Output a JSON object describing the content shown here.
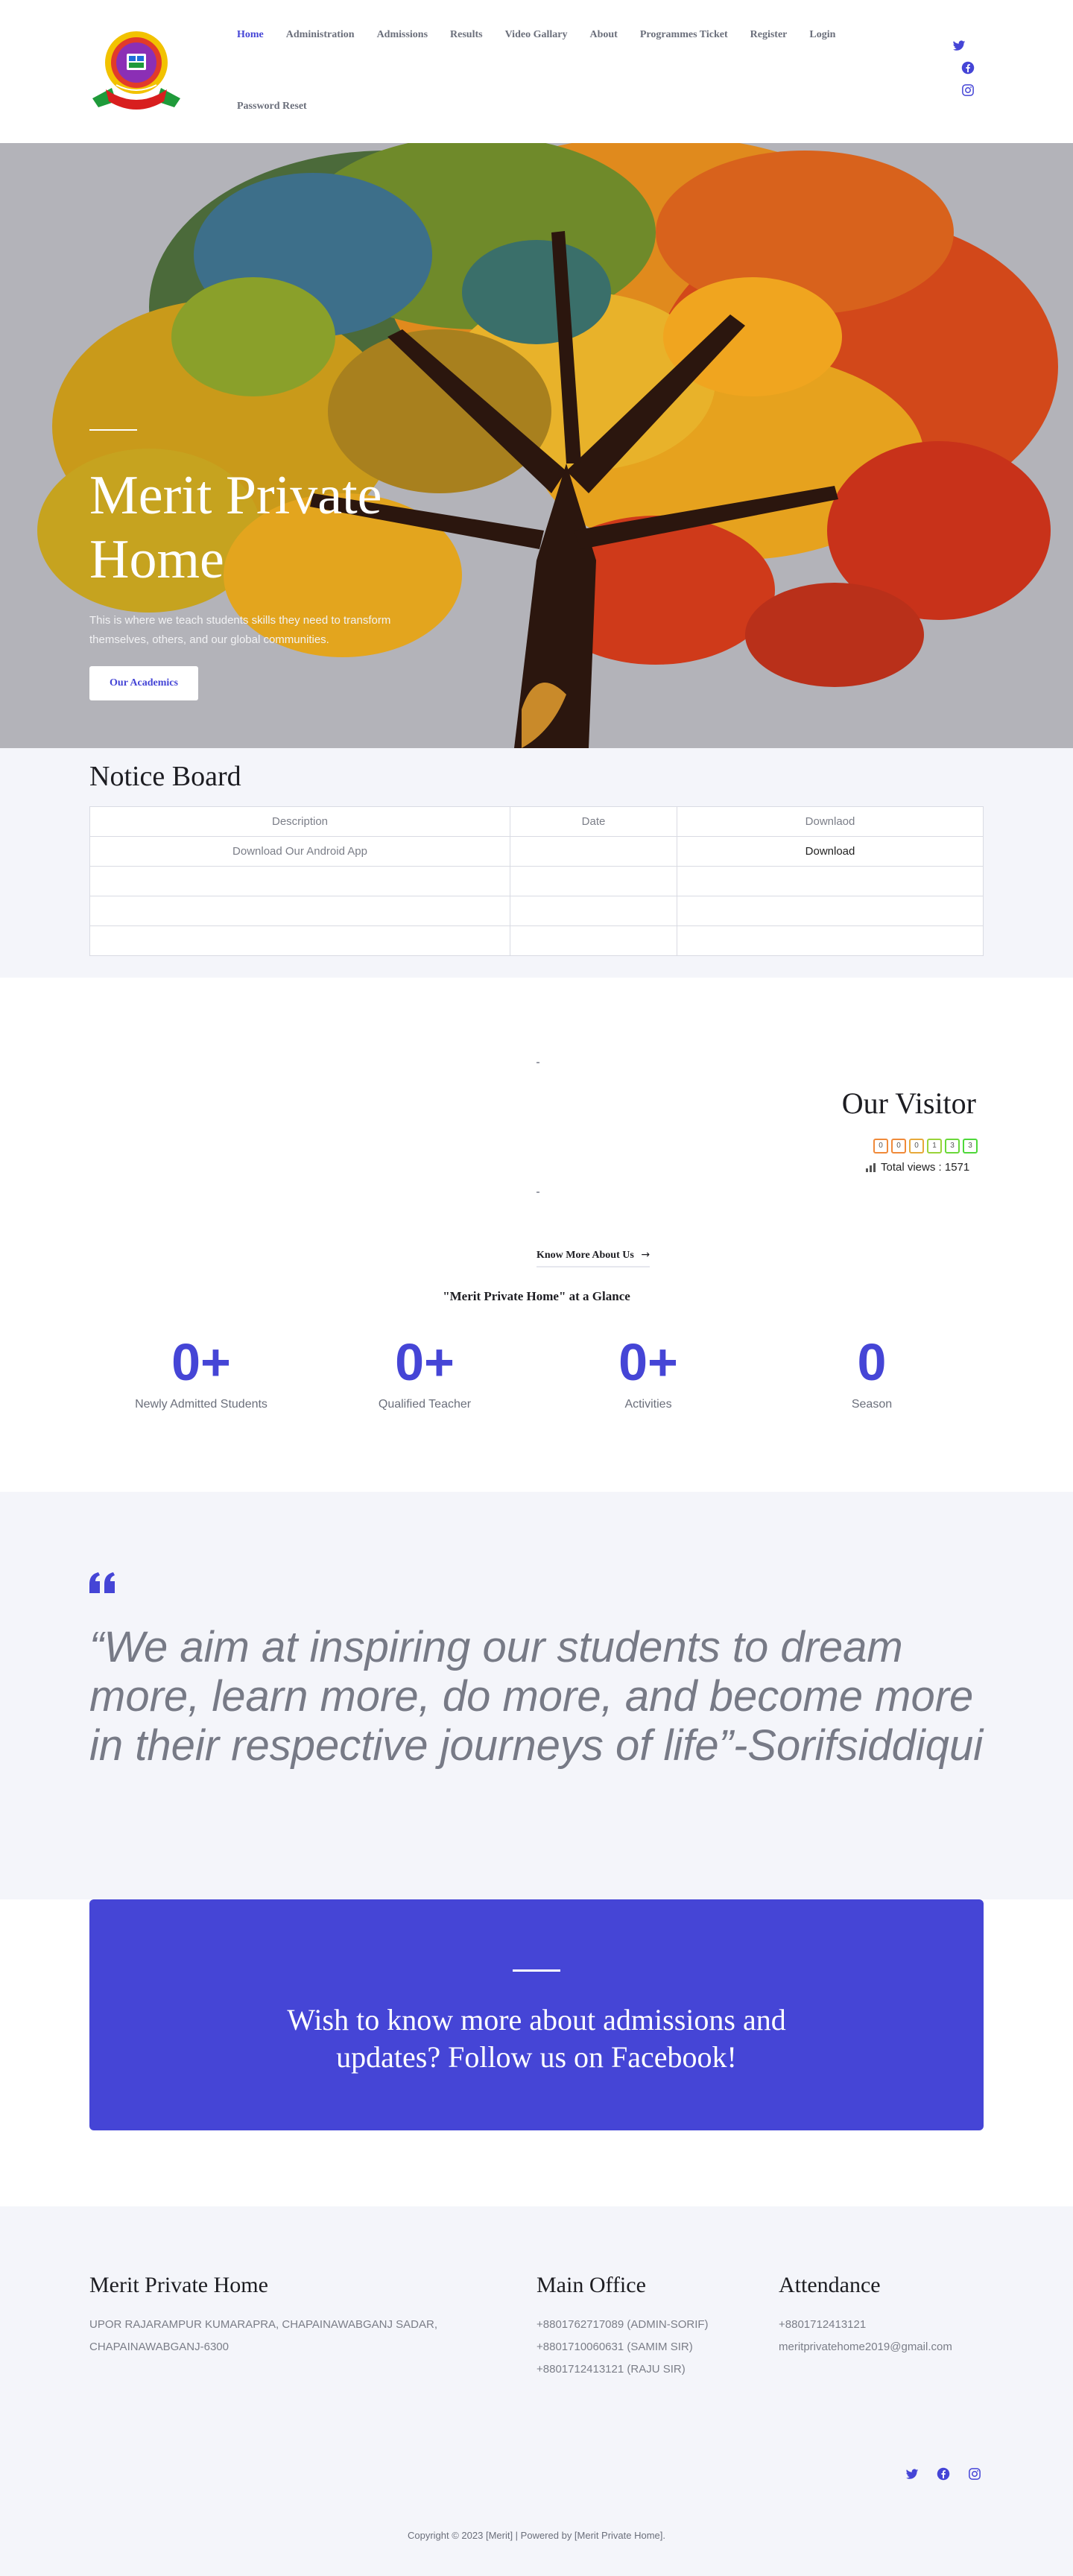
{
  "colors": {
    "accent": "#4545d6",
    "light_bg": "#f4f5fa",
    "text": "#6b6f7b"
  },
  "header": {
    "logo_icon": "school-crest-icon",
    "nav": [
      {
        "label": "Home",
        "active": true
      },
      {
        "label": "Administration"
      },
      {
        "label": "Admissions"
      },
      {
        "label": "Results"
      },
      {
        "label": "Video Gallary"
      },
      {
        "label": "About"
      },
      {
        "label": "Programmes Ticket"
      },
      {
        "label": "Register"
      },
      {
        "label": "Login"
      },
      {
        "label": "Password Reset"
      }
    ],
    "social": [
      "twitter-icon",
      "facebook-icon",
      "instagram-icon"
    ]
  },
  "hero": {
    "title_line1": "Merit Private",
    "title_line2": "Home",
    "subtitle": "This is where we teach students skills they need to transform themselves, others, and our global communities.",
    "button": "Our Academics"
  },
  "notice": {
    "title": "Notice Board",
    "columns": [
      "Description",
      "Date",
      "Downlaod"
    ],
    "rows": [
      [
        "Download Our Android App",
        "",
        "Download"
      ],
      [
        "",
        "",
        ""
      ],
      [
        "",
        "",
        ""
      ],
      [
        "",
        "",
        ""
      ]
    ]
  },
  "visitor": {
    "title": "Our Visitor",
    "counter_digits": [
      "0",
      "0",
      "0",
      "1",
      "3",
      "3"
    ],
    "total_views": "Total views : 1571"
  },
  "about": {
    "know_more": "Know More About Us",
    "glance": "\"Merit Private Home\" at a Glance",
    "stats": [
      {
        "value": "0+",
        "label": "Newly Admitted Students"
      },
      {
        "value": "0+",
        "label": "Qualified Teacher"
      },
      {
        "value": "0+",
        "label": "Activities"
      },
      {
        "value": "0",
        "label": "Season"
      }
    ]
  },
  "quote": {
    "text": "“We aim at inspiring our students to dream more, learn more, do more, and become more in their respective journeys of life”-Sorifsiddiqui"
  },
  "cta": {
    "line1": "Wish to know more about admissions and",
    "line2": "updates? Follow us on Facebook!"
  },
  "footer": {
    "col1_title": "Merit Private Home",
    "col1_lines": [
      "UPOR RAJARAMPUR KUMARAPRA, CHAPAINAWABGANJ SADAR,",
      "CHAPAINAWABGANJ-6300"
    ],
    "col2_title": "Main Office",
    "col2_lines": [
      "+8801762717089 (ADMIN-SORIF)",
      "+8801710060631 (SAMIM SIR)",
      "+8801712413121 (RAJU SIR)"
    ],
    "col3_title": "Attendance",
    "col3_lines": [
      "+8801712413121",
      "meritprivatehome2019@gmail.com"
    ],
    "social": [
      "twitter-icon",
      "facebook-icon",
      "instagram-icon"
    ],
    "copyright": "Copyright © 2023 [Merit] | Powered by [Merit Private Home]."
  }
}
